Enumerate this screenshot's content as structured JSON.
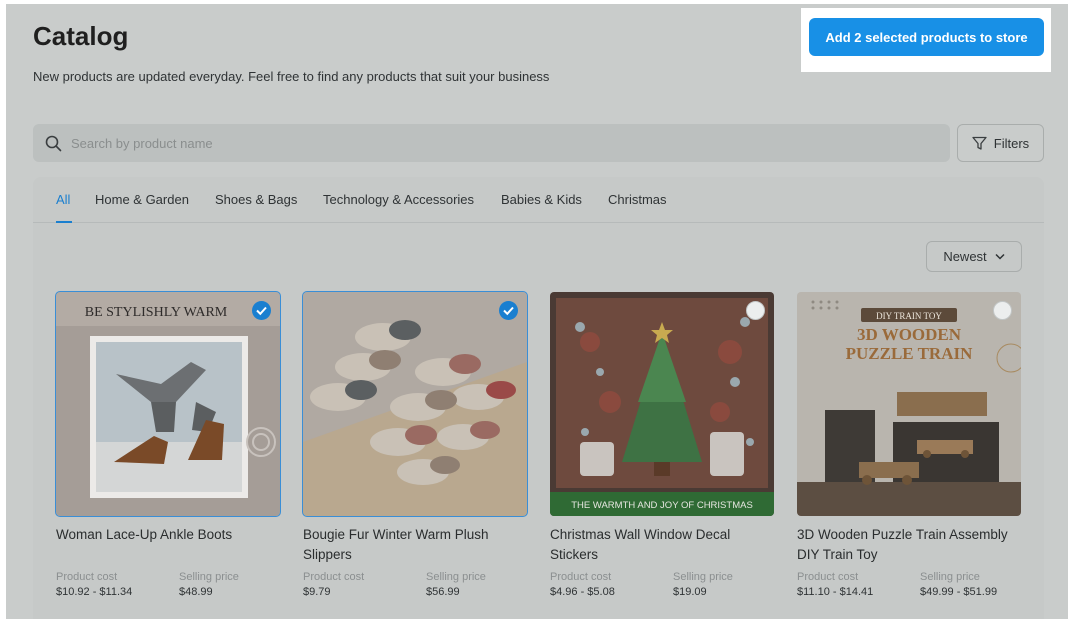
{
  "header": {
    "title": "Catalog",
    "subtitle": "New products are updated everyday. Feel free to find any products that suit your business",
    "cta_label": "Add 2 selected products to store"
  },
  "search": {
    "placeholder": "Search by product name",
    "icon": "search-icon"
  },
  "filters": {
    "label": "Filters",
    "icon": "filter-icon"
  },
  "tabs": [
    {
      "label": "All",
      "active": true
    },
    {
      "label": "Home & Garden"
    },
    {
      "label": "Shoes & Bags"
    },
    {
      "label": "Technology & Accessories"
    },
    {
      "label": "Babies & Kids"
    },
    {
      "label": "Christmas"
    }
  ],
  "sort": {
    "label": "Newest",
    "icon": "chevron-down-icon"
  },
  "cost_label": "Product cost",
  "price_label": "Selling price",
  "products": [
    {
      "name": "Woman Lace-Up Ankle Boots",
      "cost": "$10.92 - $11.34",
      "price": "$48.99",
      "selected": true,
      "banner": "BE STYLISHLY WARM"
    },
    {
      "name": "Bougie Fur Winter Warm Plush Slippers",
      "cost": "$9.79",
      "price": "$56.99",
      "selected": true
    },
    {
      "name": "Christmas Wall Window Decal Stickers",
      "cost": "$4.96 - $5.08",
      "price": "$19.09",
      "selected": false,
      "banner": "THE WARMTH AND JOY OF CHRISTMAS"
    },
    {
      "name": "3D Wooden Puzzle Train Assembly DIY Train Toy",
      "cost": "$11.10 - $14.41",
      "price": "$49.99 - $51.99",
      "selected": false,
      "banner_tag": "DIY TRAIN TOY",
      "banner_line1": "3D WOODEN",
      "banner_line2": "PUZZLE TRAIN"
    }
  ],
  "colors": {
    "accent": "#1890e6",
    "active_tab": "#1a7fcf",
    "overlay": "#c9cccb"
  }
}
